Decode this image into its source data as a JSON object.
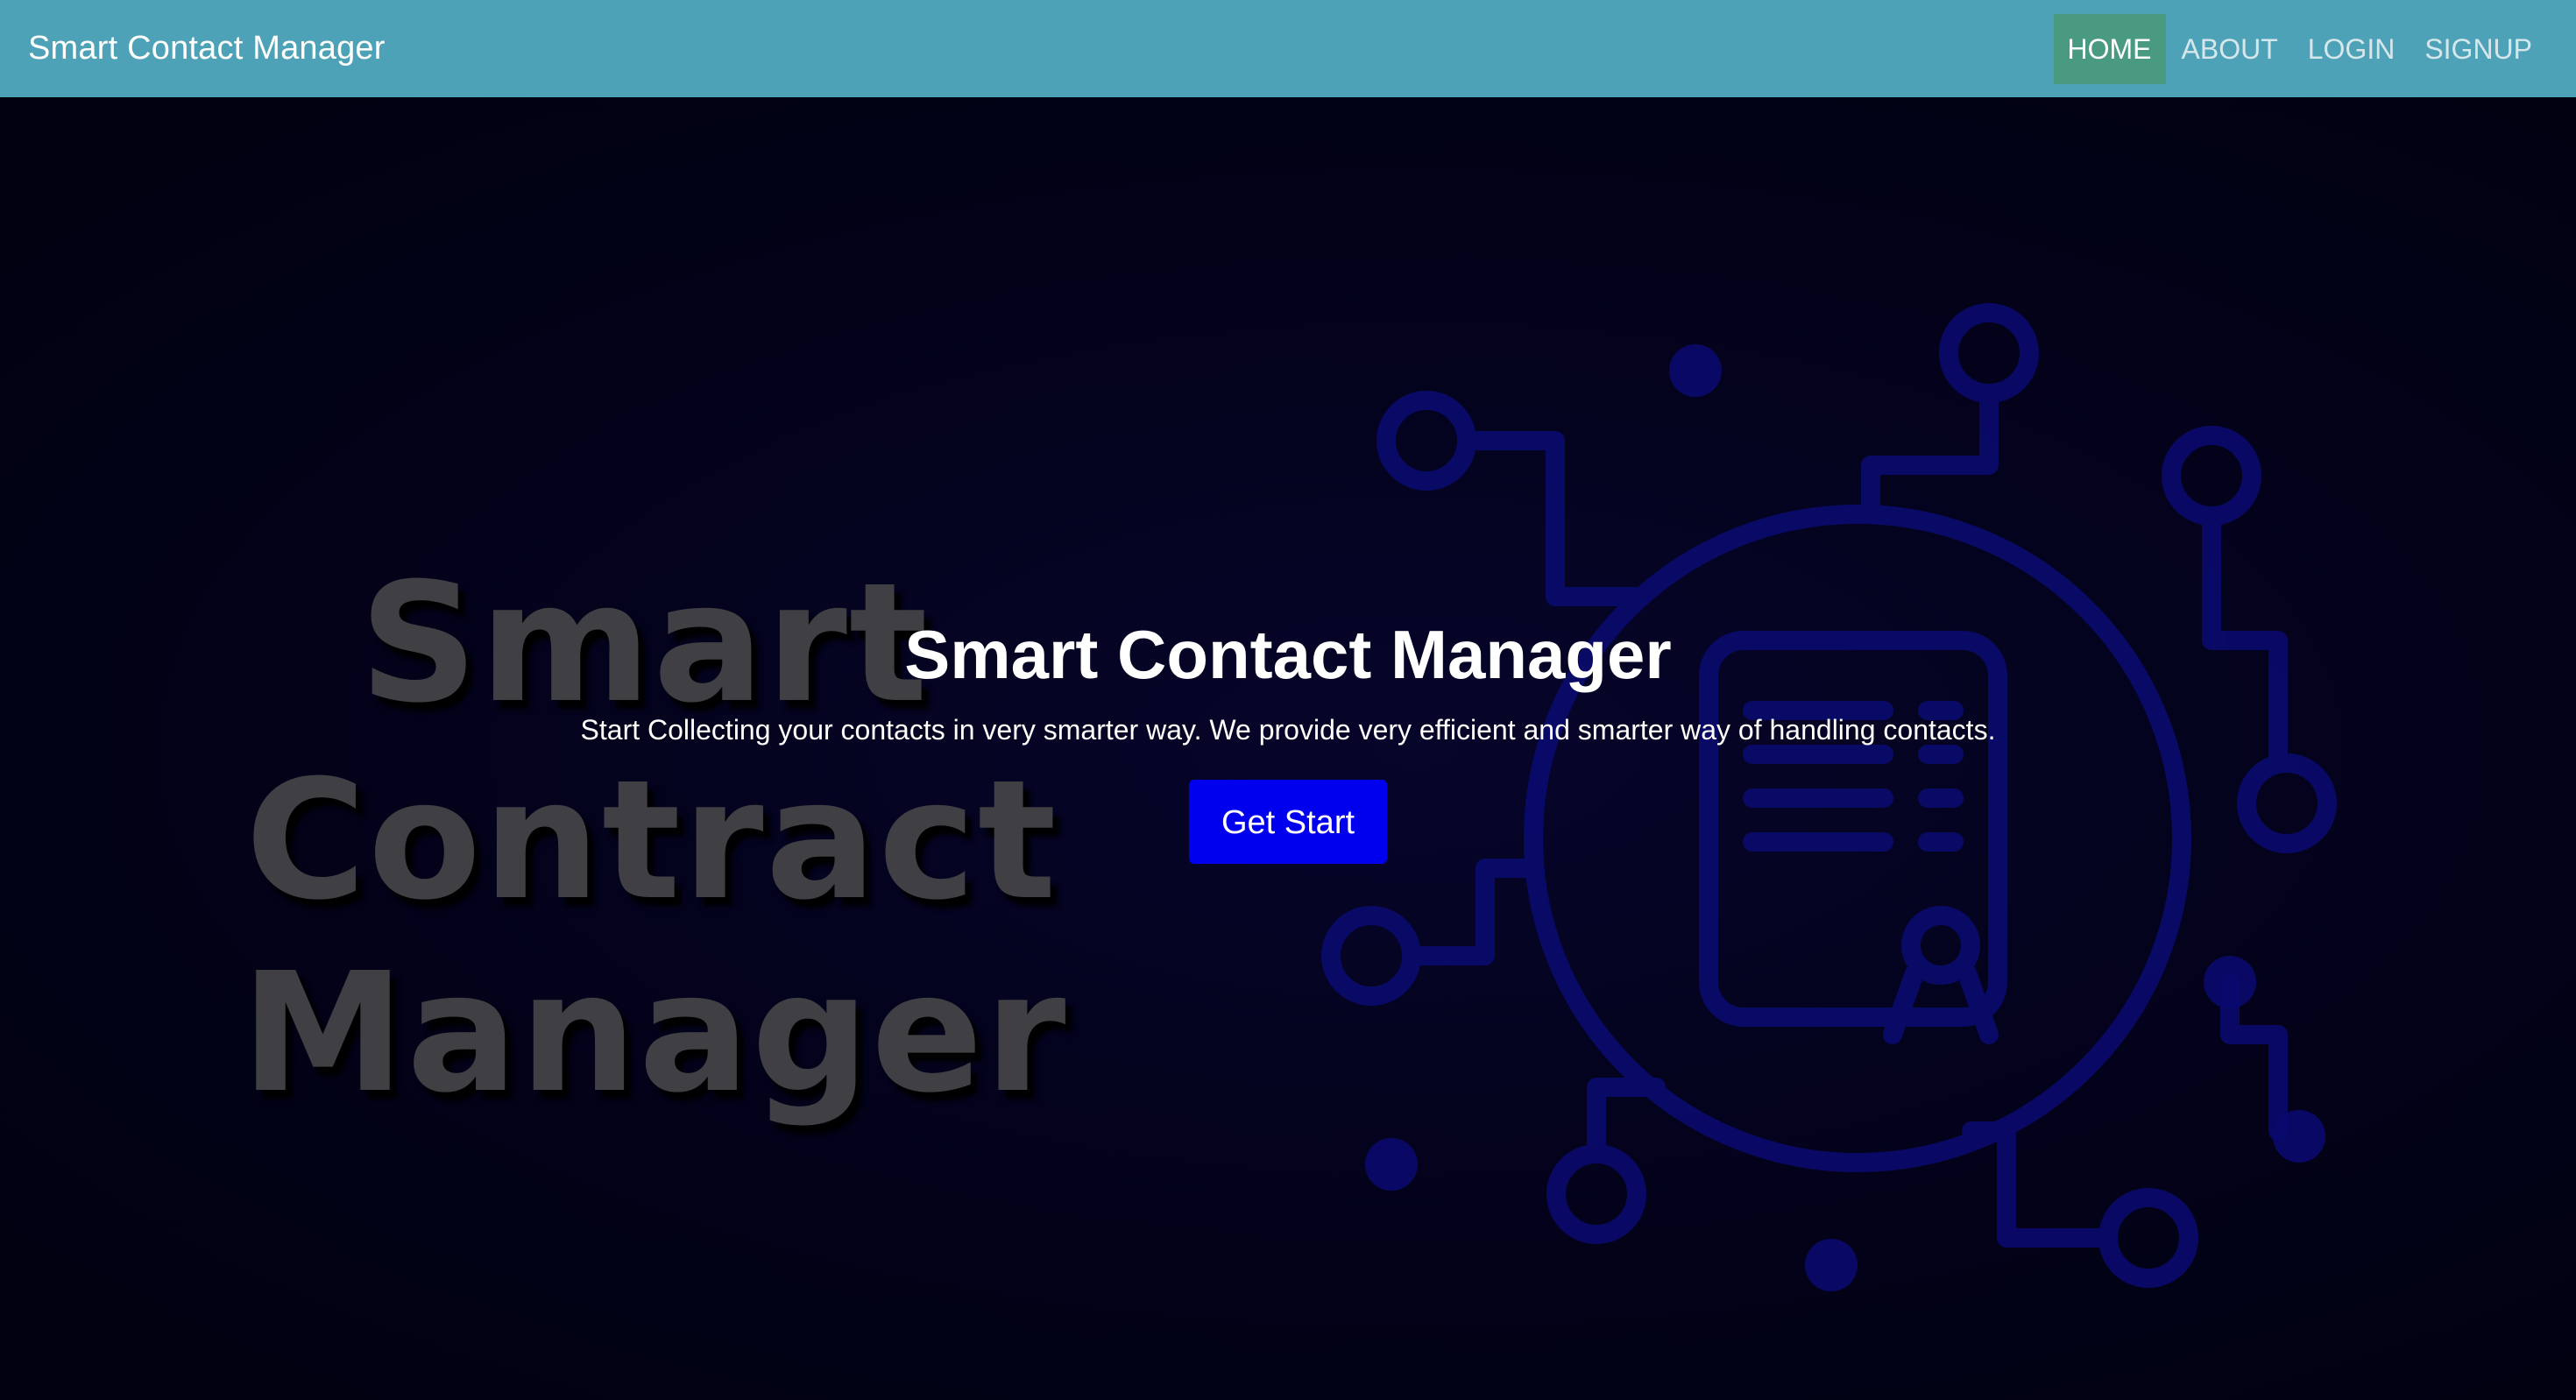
{
  "navbar": {
    "brand": "Smart Contact Manager",
    "links": [
      {
        "label": "HOME",
        "active": true
      },
      {
        "label": "ABOUT",
        "active": false
      },
      {
        "label": "LOGIN",
        "active": false
      },
      {
        "label": "SIGNUP",
        "active": false
      }
    ],
    "bar_color": "#4ea2b8",
    "active_color": "#4a9a82"
  },
  "hero": {
    "title": "Smart Contact Manager",
    "subtitle": "Start Collecting your contacts in very smarter way. We provide very efficient and smarter way of handling contacts.",
    "cta_label": "Get Start",
    "cta_color": "#0000ee",
    "background_image": {
      "watermark_lines": [
        "Smart",
        "Contract",
        "Manager"
      ],
      "icon": "network-certificate-icon",
      "icon_color": "#0a0a6e"
    }
  }
}
